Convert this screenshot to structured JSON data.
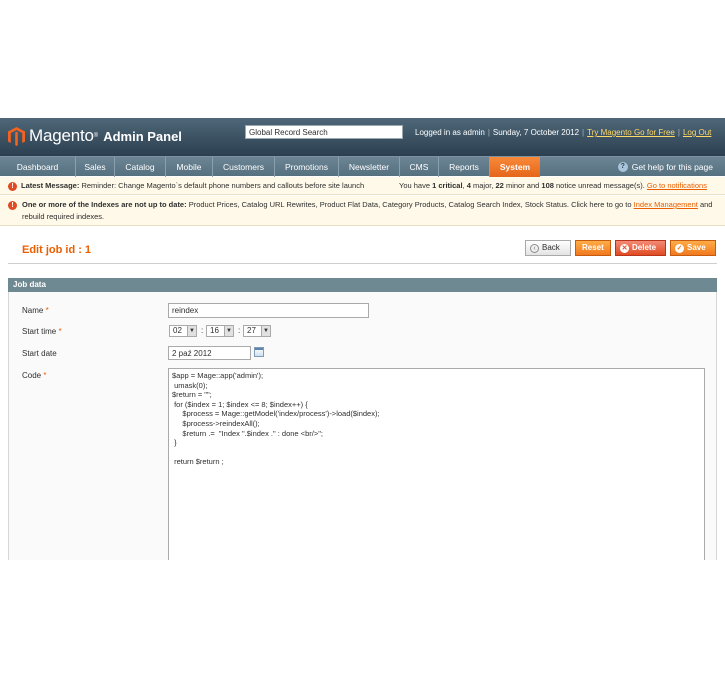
{
  "header": {
    "brand": "Magento",
    "brand_tm": "®",
    "brand_sub": "Admin Panel",
    "search_value": "Global Record Search",
    "logged_in": "Logged in as admin",
    "date": "Sunday, 7 October 2012",
    "try_link": "Try Magento Go for Free",
    "logout": "Log Out"
  },
  "nav": {
    "items": [
      "Dashboard",
      "Sales",
      "Catalog",
      "Mobile",
      "Customers",
      "Promotions",
      "Newsletter",
      "CMS",
      "Reports",
      "System"
    ],
    "active": "System",
    "help": "Get help for this page",
    "help_icon": "question-icon"
  },
  "notices": {
    "latest_label": "Latest Message:",
    "latest_text": "Reminder: Change Magento`s default phone numbers and callouts before site launch",
    "summary_pre": "You have",
    "critical_count": "1 critical",
    "major_count": "4",
    "major_label": "major,",
    "minor_count": "22",
    "minor_label": "minor and",
    "notice_count": "108",
    "notice_label": "notice unread message(s).",
    "goto": "Go to notifications",
    "index_bold": "One or more of the Indexes are not up to date:",
    "index_text": "Product Prices, Catalog URL Rewrites, Product Flat Data, Category Products, Catalog Search Index, Stock Status. Click here to go to",
    "index_link": "Index Management",
    "index_tail": "and rebuild required indexes."
  },
  "content": {
    "title": "Edit job id : 1",
    "buttons": {
      "back": "Back",
      "reset": "Reset",
      "delete": "Delete",
      "save": "Save"
    }
  },
  "form": {
    "legend": "Job data",
    "name_label": "Name",
    "name_value": "reindex",
    "start_time_label": "Start time",
    "hour": "02",
    "minute": "16",
    "second": "27",
    "start_date_label": "Start date",
    "start_date": "2 paź 2012",
    "code_label": "Code",
    "required_mark": "*",
    "time_sep": ":",
    "code": "$app = Mage::app('admin');\n umask(0);\n$return = \"\";\n for ($index = 1; $index <= 8; $index++) {\n     $process = Mage::getModel('index/process')->load($index);\n     $process->reindexAll();\n     $return .=  \"Index \".$index .\" : done <br/>\";\n }\n\n return $return ;"
  }
}
